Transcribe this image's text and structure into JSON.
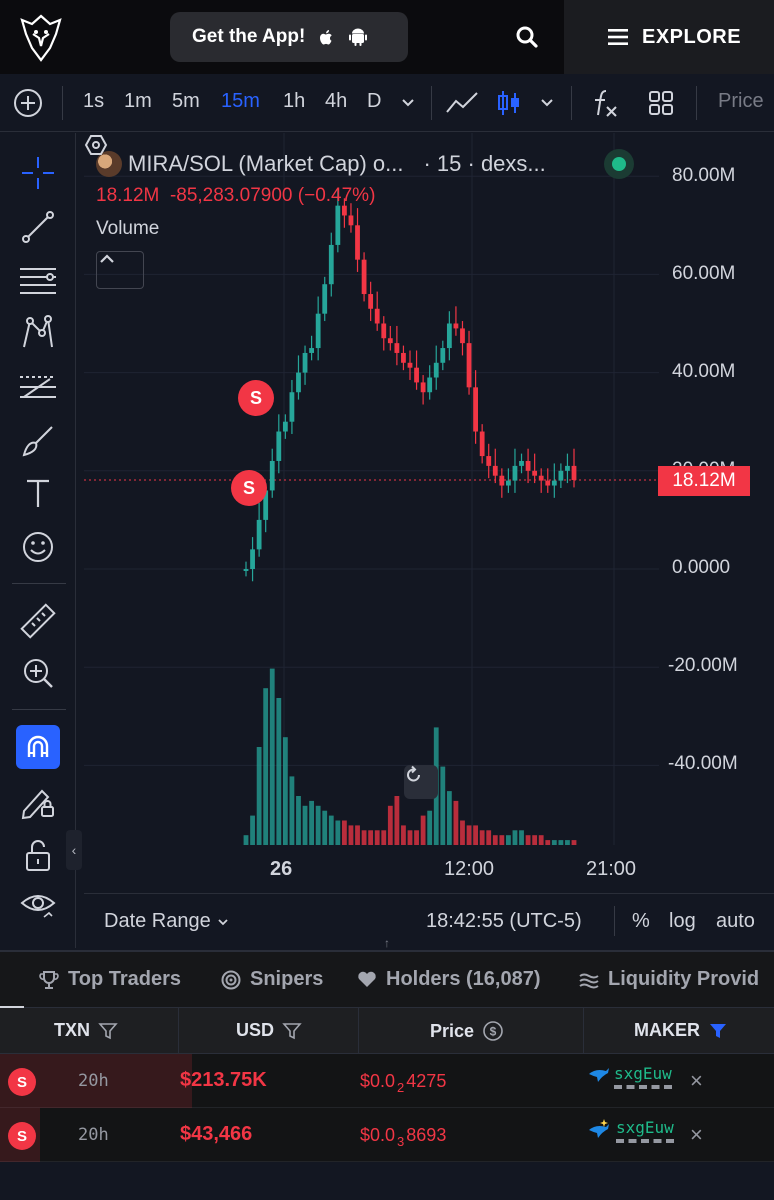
{
  "topnav": {
    "get_app_label": "Get the App!",
    "explore_label": "EXPLORE"
  },
  "toolbar": {
    "timeframes": [
      "1s",
      "1m",
      "5m",
      "15m",
      "1h",
      "4h",
      "D"
    ],
    "active_timeframe": "15m",
    "price_label": "Price"
  },
  "chart": {
    "title": "MIRA/SOL (Market Cap) o...",
    "interval_source": "· 15 · dexs...",
    "last_value": "18.12M",
    "change": "-85,283.07900 (−0.47%)",
    "volume_label": "Volume",
    "price_tag": "18.12M",
    "marker_label": "S",
    "y_axis_labels": [
      "80.00M",
      "60.00M",
      "40.00M",
      "20.00M",
      "0.0000",
      "-20.00M",
      "-40.00M"
    ],
    "x_axis_labels": [
      "26",
      "12:00",
      "21:00"
    ],
    "colors": {
      "up": "#26a69a",
      "down": "#f23645",
      "background": "#131722",
      "accent": "#2962ff"
    }
  },
  "chart_data": {
    "type": "candlestick",
    "title": "MIRA/SOL (Market Cap)",
    "y_unit": "USD market cap (millions)",
    "ylim": [
      -55,
      85
    ],
    "last_value": 18.12,
    "close_series": [
      0,
      4,
      10,
      16,
      22,
      28,
      30,
      36,
      40,
      44,
      45,
      52,
      58,
      66,
      74,
      72,
      70,
      63,
      56,
      53,
      50,
      47,
      46,
      44,
      42,
      41,
      38,
      36,
      39,
      42,
      45,
      50,
      49,
      46,
      37,
      28,
      23,
      21,
      19,
      17,
      18,
      21,
      22,
      20,
      19,
      18,
      17,
      18,
      20,
      21,
      18.12
    ],
    "volume_series": [
      2,
      6,
      20,
      32,
      36,
      30,
      22,
      14,
      10,
      8,
      9,
      8,
      7,
      6,
      5,
      5,
      4,
      4,
      3,
      3,
      3,
      3,
      8,
      10,
      4,
      3,
      3,
      6,
      7,
      24,
      16,
      11,
      9,
      5,
      4,
      4,
      3,
      3,
      2,
      2,
      2,
      3,
      3,
      2,
      2,
      2,
      1,
      1,
      1,
      1,
      1
    ],
    "sell_markers": [
      36,
      18
    ],
    "x_ticks": [
      "26",
      "12:00",
      "21:00"
    ],
    "grid": true
  },
  "bottom_bar": {
    "date_range": "Date Range",
    "clock": "18:42:55 (UTC-5)",
    "percent": "%",
    "log": "log",
    "auto": "auto"
  },
  "tabs": [
    {
      "label": "Top Traders",
      "icon": "trophy-icon"
    },
    {
      "label": "Snipers",
      "icon": "target-icon"
    },
    {
      "label": "Holders (16,087)",
      "icon": "heart-icon"
    },
    {
      "label": "Liquidity Provid",
      "icon": "liquidity-icon"
    }
  ],
  "table": {
    "headers": {
      "txn": "TXN",
      "usd": "USD",
      "price": "Price",
      "maker": "MAKER"
    },
    "rows": [
      {
        "type": "S",
        "age": "20h",
        "usd": "$213.75K",
        "price_prefix": "$0.0",
        "price_zeros": "2",
        "price_digits": "4275",
        "maker": "sxgEuw"
      },
      {
        "type": "S",
        "age": "20h",
        "usd": "$43,466",
        "price_prefix": "$0.0",
        "price_zeros": "3",
        "price_digits": "8693",
        "maker": "sxgEuw"
      }
    ]
  }
}
